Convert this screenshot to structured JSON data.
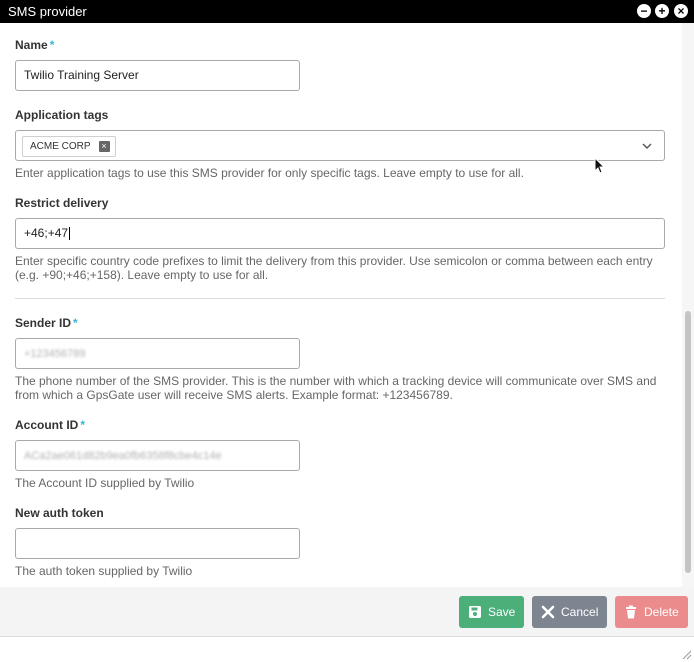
{
  "window": {
    "title": "SMS provider"
  },
  "icons": {
    "minimize": "minimize-icon",
    "maximize": "maximize-icon",
    "close": "close-icon"
  },
  "form": {
    "name": {
      "label": "Name",
      "required": "*",
      "value": "Twilio Training Server"
    },
    "application_tags": {
      "label": "Application tags",
      "tags": [
        "ACME CORP"
      ],
      "help": "Enter application tags to use this SMS provider for only specific tags. Leave empty to use for all."
    },
    "restrict_delivery": {
      "label": "Restrict delivery",
      "value": "+46;+47",
      "help_line1": "Enter specific country code prefixes to limit the delivery from this provider. Use semicolon or comma between each entry",
      "help_line2": "(e.g. +90;+46;+158). Leave empty to use for all."
    },
    "sender_id": {
      "label": "Sender ID",
      "required": "*",
      "value": "+123456789",
      "help_line1": "The phone number of the SMS provider. This is the number with which a tracking device will communicate over SMS and",
      "help_line2": "from which a GpsGate user will receive SMS alerts. Example format: +123456789."
    },
    "account_id": {
      "label": "Account ID",
      "required": "*",
      "value": "ACa2ae061d82b9ea0fb6358f8cbe4c14e",
      "help": "The Account ID supplied by Twilio"
    },
    "auth_token": {
      "label": "New auth token",
      "value": "",
      "help": "The auth token supplied by Twilio"
    }
  },
  "footer": {
    "save_label": "Save",
    "cancel_label": "Cancel",
    "delete_label": "Delete"
  },
  "colors": {
    "titlebar": "#000000",
    "required": "#3ab4d4",
    "save": "#4caf79",
    "cancel": "#7d8590",
    "delete": "#ec8b8b"
  }
}
